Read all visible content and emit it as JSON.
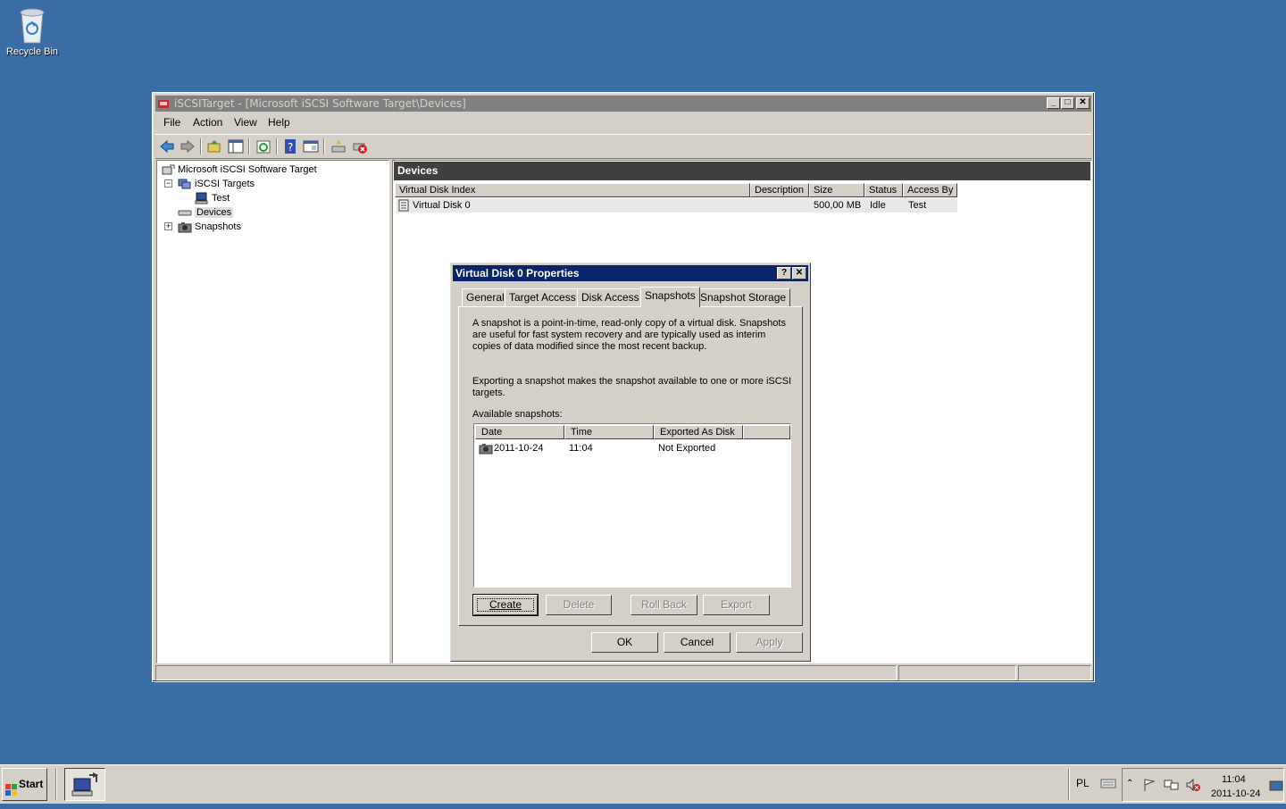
{
  "desktop": {
    "recycle_bin_label": "Recycle Bin"
  },
  "window": {
    "title": "iSCSITarget - [Microsoft iSCSI Software Target\\Devices]",
    "menu": [
      "File",
      "Action",
      "View",
      "Help"
    ],
    "toolbar_icons": [
      "back-icon",
      "forward-icon",
      "up-folder-icon",
      "show-hide-tree-icon",
      "refresh-icon",
      "help-icon",
      "properties-icon",
      "create-disk-icon",
      "delete-icon"
    ]
  },
  "tree": {
    "root": "Microsoft iSCSI Software Target",
    "targets": "iSCSI Targets",
    "target_test": "Test",
    "devices": "Devices",
    "snapshots": "Snapshots"
  },
  "devices": {
    "header": "Devices",
    "columns": [
      "Virtual Disk Index",
      "Description",
      "Size",
      "Status",
      "Access By"
    ],
    "rows": [
      {
        "index": "Virtual Disk 0",
        "description": "",
        "size": "500,00 MB",
        "status": "Idle",
        "access_by": "Test"
      }
    ]
  },
  "dialog": {
    "title": "Virtual Disk 0 Properties",
    "tabs": [
      "General",
      "Target Access",
      "Disk Access",
      "Snapshots",
      "Snapshot Storage"
    ],
    "active_tab": "Snapshots",
    "para1": "A snapshot is a point-in-time, read-only copy of a virtual disk. Snapshots are useful for fast system recovery and are typically used as interim copies of data modified since the most recent backup.",
    "para2": "Exporting a snapshot makes the snapshot available to one or more iSCSI targets.",
    "available_label": "Available snapshots:",
    "list_columns": [
      "Date",
      "Time",
      "Exported As Disk"
    ],
    "snapshots": [
      {
        "date": "2011-10-24",
        "time": "11:04",
        "exported": "Not Exported"
      }
    ],
    "buttons": {
      "create": "Create",
      "delete": "Delete",
      "rollback": "Roll Back",
      "export": "Export"
    },
    "footer": {
      "ok": "OK",
      "cancel": "Cancel",
      "apply": "Apply"
    }
  },
  "taskbar": {
    "start": "Start",
    "lang": "PL",
    "time": "11:04",
    "date": "2011-10-24"
  }
}
